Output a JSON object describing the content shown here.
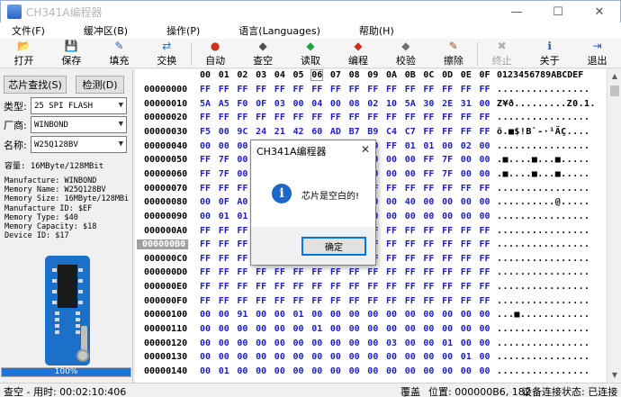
{
  "window": {
    "title": "CH341A编程器",
    "minimize": "—",
    "maximize": "☐",
    "close": "✕"
  },
  "menu": [
    "文件(F)",
    "缓冲区(B)",
    "操作(P)",
    "语言(Languages)",
    "帮助(H)"
  ],
  "toolbar": [
    {
      "label": "打开",
      "icon": "open-folder-icon",
      "glyph": "📂",
      "color": "#d8a020"
    },
    {
      "label": "保存",
      "icon": "save-disk-icon",
      "glyph": "💾",
      "color": "#3060c0"
    },
    {
      "label": "填充",
      "icon": "fill-pencil-icon",
      "glyph": "✎",
      "color": "#3060c0"
    },
    {
      "label": "交换",
      "icon": "swap-arrows-icon",
      "glyph": "⇄",
      "color": "#2070d0"
    },
    {
      "label": "自动",
      "icon": "auto-icon",
      "glyph": "●",
      "color": "#d03020"
    },
    {
      "label": "查空",
      "icon": "blank-check-icon",
      "glyph": "◆",
      "color": "#505050"
    },
    {
      "label": "读取",
      "icon": "read-icon",
      "glyph": "◆",
      "color": "#20a040"
    },
    {
      "label": "编程",
      "icon": "program-icon",
      "glyph": "◆",
      "color": "#d03020"
    },
    {
      "label": "校验",
      "icon": "verify-icon",
      "glyph": "◆",
      "color": "#707070"
    },
    {
      "label": "擦除",
      "icon": "erase-icon",
      "glyph": "✎",
      "color": "#a05020"
    },
    {
      "label": "终止",
      "icon": "stop-icon",
      "glyph": "✖",
      "color": "#b0b0b0",
      "disabled": true
    },
    {
      "label": "关于",
      "icon": "about-info-icon",
      "glyph": "ℹ",
      "color": "#2060c0"
    },
    {
      "label": "退出",
      "icon": "exit-icon",
      "glyph": "⇥",
      "color": "#2060c0"
    }
  ],
  "left": {
    "find_chip": "芯片查找(S)",
    "detect": "检测(D)",
    "type_label": "类型:",
    "type_value": "25 SPI FLASH",
    "vendor_label": "厂商:",
    "vendor_value": "WINBOND",
    "name_label": "名称:",
    "name_value": "W25Q128BV",
    "capacity": "容量: 16MByte/128MBit",
    "info": [
      "Manufacture: WINBOND",
      "Memory Name: W25Q128BV",
      "Memory Size: 16MByte/128MBi",
      "Manufacture ID: $EF",
      "Memory Type: $40",
      "Memory Capacity: $18",
      "Device ID: $17"
    ],
    "progress_value": 100,
    "progress_text": "100%"
  },
  "hex": {
    "columns": [
      "00",
      "01",
      "02",
      "03",
      "04",
      "05",
      "06",
      "07",
      "08",
      "09",
      "0A",
      "0B",
      "0C",
      "0D",
      "0E",
      "0F"
    ],
    "ascii_header": "0123456789ABCDEF",
    "selected_column": "06",
    "selected_address": "000000B0",
    "rows": [
      {
        "addr": "00000000",
        "bytes": [
          "FF",
          "FF",
          "FF",
          "FF",
          "FF",
          "FF",
          "FF",
          "FF",
          "FF",
          "FF",
          "FF",
          "FF",
          "FF",
          "FF",
          "FF",
          "FF"
        ],
        "ascii": "................"
      },
      {
        "addr": "00000010",
        "bytes": [
          "5A",
          "A5",
          "F0",
          "0F",
          "03",
          "00",
          "04",
          "00",
          "08",
          "02",
          "10",
          "5A",
          "30",
          "2E",
          "31",
          "00"
        ],
        "ascii": "Z¥ð.........Z0.1."
      },
      {
        "addr": "00000020",
        "bytes": [
          "FF",
          "FF",
          "FF",
          "FF",
          "FF",
          "FF",
          "FF",
          "FF",
          "FF",
          "FF",
          "FF",
          "FF",
          "FF",
          "FF",
          "FF",
          "FF"
        ],
        "ascii": "................"
      },
      {
        "addr": "00000030",
        "bytes": [
          "F5",
          "00",
          "9C",
          "24",
          "21",
          "42",
          "60",
          "AD",
          "B7",
          "B9",
          "C4",
          "C7",
          "FF",
          "FF",
          "FF",
          "FF"
        ],
        "ascii": "õ.■$!B`-·¹ÄÇ...."
      },
      {
        "addr": "00000040",
        "bytes": [
          "00",
          "00",
          "00",
          "00",
          "00",
          "00",
          "00",
          "00",
          "00",
          "00",
          "FF",
          "01",
          "01",
          "00",
          "02",
          "00"
        ],
        "ascii": "................"
      },
      {
        "addr": "00000050",
        "bytes": [
          "FF",
          "7F",
          "00",
          "00",
          "00",
          "00",
          "00",
          "00",
          "00",
          "00",
          "00",
          "00",
          "FF",
          "7F",
          "00",
          "00"
        ],
        "ascii": ".■....■...■....."
      },
      {
        "addr": "00000060",
        "bytes": [
          "FF",
          "7F",
          "00",
          "00",
          "00",
          "00",
          "00",
          "00",
          "00",
          "00",
          "00",
          "00",
          "FF",
          "7F",
          "00",
          "00"
        ],
        "ascii": ".■....■...■....."
      },
      {
        "addr": "00000070",
        "bytes": [
          "FF",
          "FF",
          "FF",
          "FF",
          "FF",
          "FF",
          "FF",
          "FF",
          "FF",
          "FF",
          "FF",
          "FF",
          "FF",
          "FF",
          "FF",
          "FF"
        ],
        "ascii": "................"
      },
      {
        "addr": "00000080",
        "bytes": [
          "00",
          "0F",
          "A0",
          "00",
          "00",
          "00",
          "00",
          "00",
          "00",
          "00",
          "00",
          "40",
          "00",
          "00",
          "00",
          "00"
        ],
        "ascii": "..........@....."
      },
      {
        "addr": "00000090",
        "bytes": [
          "00",
          "01",
          "01",
          "00",
          "00",
          "00",
          "00",
          "00",
          "00",
          "00",
          "00",
          "00",
          "00",
          "00",
          "00",
          "00"
        ],
        "ascii": "................"
      },
      {
        "addr": "000000A0",
        "bytes": [
          "FF",
          "FF",
          "FF",
          "FF",
          "FF",
          "FF",
          "FF",
          "FF",
          "FF",
          "FF",
          "FF",
          "FF",
          "FF",
          "FF",
          "FF",
          "FF"
        ],
        "ascii": "................"
      },
      {
        "addr": "000000B0",
        "bytes": [
          "FF",
          "FF",
          "FF",
          "FF",
          "FF",
          "FF",
          "FF",
          "FF",
          "FF",
          "FF",
          "FF",
          "FF",
          "FF",
          "FF",
          "FF",
          "FF"
        ],
        "ascii": "................"
      },
      {
        "addr": "000000C0",
        "bytes": [
          "FF",
          "FF",
          "FF",
          "FF",
          "FF",
          "FF",
          "FF",
          "FF",
          "FF",
          "FF",
          "FF",
          "FF",
          "FF",
          "FF",
          "FF",
          "FF"
        ],
        "ascii": "................"
      },
      {
        "addr": "000000D0",
        "bytes": [
          "FF",
          "FF",
          "FF",
          "FF",
          "FF",
          "FF",
          "FF",
          "FF",
          "FF",
          "FF",
          "FF",
          "FF",
          "FF",
          "FF",
          "FF",
          "FF"
        ],
        "ascii": "................"
      },
      {
        "addr": "000000E0",
        "bytes": [
          "FF",
          "FF",
          "FF",
          "FF",
          "FF",
          "FF",
          "FF",
          "FF",
          "FF",
          "FF",
          "FF",
          "FF",
          "FF",
          "FF",
          "FF",
          "FF"
        ],
        "ascii": "................"
      },
      {
        "addr": "000000F0",
        "bytes": [
          "FF",
          "FF",
          "FF",
          "FF",
          "FF",
          "FF",
          "FF",
          "FF",
          "FF",
          "FF",
          "FF",
          "FF",
          "FF",
          "FF",
          "FF",
          "FF"
        ],
        "ascii": "................"
      },
      {
        "addr": "00000100",
        "bytes": [
          "00",
          "00",
          "91",
          "00",
          "00",
          "01",
          "00",
          "00",
          "00",
          "00",
          "00",
          "00",
          "00",
          "00",
          "00",
          "00"
        ],
        "ascii": "...■............"
      },
      {
        "addr": "00000110",
        "bytes": [
          "00",
          "00",
          "00",
          "00",
          "00",
          "00",
          "01",
          "00",
          "00",
          "00",
          "00",
          "00",
          "00",
          "00",
          "00",
          "00"
        ],
        "ascii": "................"
      },
      {
        "addr": "00000120",
        "bytes": [
          "00",
          "00",
          "00",
          "00",
          "00",
          "00",
          "00",
          "00",
          "00",
          "00",
          "03",
          "00",
          "00",
          "01",
          "00",
          "00"
        ],
        "ascii": "................"
      },
      {
        "addr": "00000130",
        "bytes": [
          "00",
          "00",
          "00",
          "00",
          "00",
          "00",
          "00",
          "00",
          "00",
          "00",
          "00",
          "00",
          "00",
          "00",
          "01",
          "00"
        ],
        "ascii": "................"
      },
      {
        "addr": "00000140",
        "bytes": [
          "00",
          "01",
          "00",
          "00",
          "00",
          "00",
          "00",
          "00",
          "00",
          "00",
          "00",
          "00",
          "00",
          "00",
          "00",
          "00"
        ],
        "ascii": "................"
      }
    ]
  },
  "status": {
    "op": "查空 - 用时: 00:02:10:406",
    "mode": "覆盖",
    "position": "位置: 000000B6, 182",
    "connection": "设备连接状态: 已连接"
  },
  "dialog": {
    "title": "CH341A编程器",
    "message": "芯片是空白的!",
    "ok": "确定",
    "close": "✕",
    "icon_glyph": "i"
  }
}
